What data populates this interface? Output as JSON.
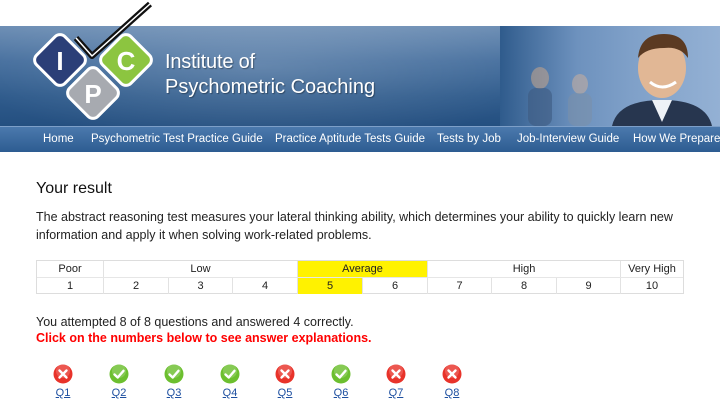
{
  "brand": {
    "line1": "Institute of",
    "line2": "Psychometric Coaching",
    "logo_letters": [
      "I",
      "P",
      "C"
    ]
  },
  "nav": {
    "items": [
      {
        "label": "Home"
      },
      {
        "label": "Psychometric Test Practice Guide"
      },
      {
        "label": "Practice Aptitude Tests Guide"
      },
      {
        "label": "Tests by Job"
      },
      {
        "label": "Job-Interview Guide"
      },
      {
        "label": "How We Prepare"
      }
    ]
  },
  "result": {
    "title": "Your result",
    "description": "The abstract reasoning test measures your lateral thinking ability, which determines your ability to quickly learn new information and apply it when solving work-related problems.",
    "scale": {
      "bands": [
        "Poor",
        "Low",
        "Average",
        "High",
        "Very High"
      ],
      "highlighted_band": "Average",
      "numbers": [
        "1",
        "2",
        "3",
        "4",
        "5",
        "6",
        "7",
        "8",
        "9",
        "10"
      ],
      "score": "5",
      "highlight_color": "#fff200"
    },
    "attempt_text": "You attempted 8 of 8 questions and answered 4 correctly.",
    "click_text": "Click on the numbers below to see answer explanations."
  },
  "questions": [
    {
      "label": "Q1",
      "status": "wrong",
      "icon": "cross-icon"
    },
    {
      "label": "Q2",
      "status": "correct",
      "icon": "check-icon"
    },
    {
      "label": "Q3",
      "status": "correct",
      "icon": "check-icon"
    },
    {
      "label": "Q4",
      "status": "correct",
      "icon": "check-icon"
    },
    {
      "label": "Q5",
      "status": "wrong",
      "icon": "cross-icon"
    },
    {
      "label": "Q6",
      "status": "correct",
      "icon": "check-icon"
    },
    {
      "label": "Q7",
      "status": "wrong",
      "icon": "cross-icon"
    },
    {
      "label": "Q8",
      "status": "wrong",
      "icon": "cross-icon"
    }
  ],
  "colors": {
    "correct": "#6cbf2f",
    "wrong": "#e8332a",
    "link": "#1d4fa0",
    "alert": "#ff0000"
  }
}
